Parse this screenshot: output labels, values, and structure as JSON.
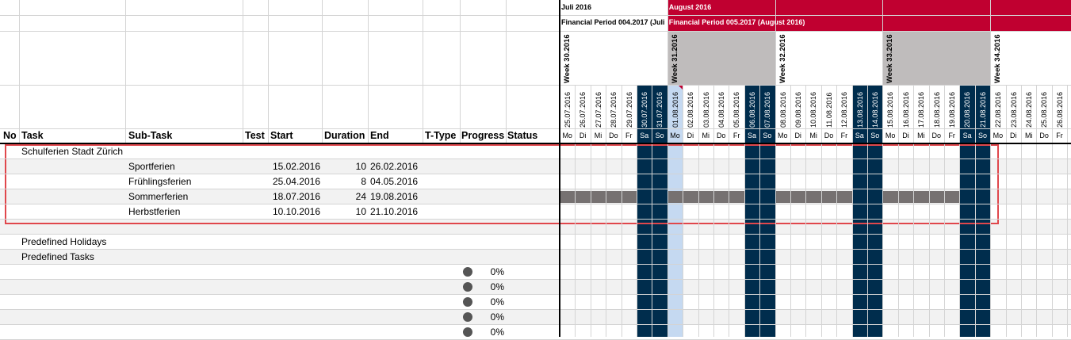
{
  "columns": {
    "no": "No",
    "task": "Task",
    "subtask": "Sub-Task",
    "test": "Test",
    "start": "Start",
    "duration": "Duration",
    "end": "End",
    "ttype": "T-Type",
    "progress": "Progress",
    "status": "Status"
  },
  "months": [
    {
      "label": "Juli 2016",
      "period": "Financial Period 004.2017 (Juli",
      "color": "#ffffff"
    },
    {
      "label": "August 2016",
      "period": "Financial Period 005.2017 (August 2016)",
      "color": "#c00030"
    }
  ],
  "weeks": [
    "Week 30.2016",
    "Week 31.2016",
    "Week 32.2016",
    "Week 33.2016",
    "Week 34.2016"
  ],
  "days": [
    {
      "date": "25.07.2016",
      "dow": "Mo"
    },
    {
      "date": "26.07.2016",
      "dow": "Di"
    },
    {
      "date": "27.07.2016",
      "dow": "Mi"
    },
    {
      "date": "28.07.2016",
      "dow": "Do"
    },
    {
      "date": "29.07.2016",
      "dow": "Fr"
    },
    {
      "date": "30.07.2016",
      "dow": "Sa"
    },
    {
      "date": "31.07.2016",
      "dow": "So"
    },
    {
      "date": "01.08.2016",
      "dow": "Mo"
    },
    {
      "date": "02.08.2016",
      "dow": "Di"
    },
    {
      "date": "03.08.2016",
      "dow": "Mi"
    },
    {
      "date": "04.08.2016",
      "dow": "Do"
    },
    {
      "date": "05.08.2016",
      "dow": "Fr"
    },
    {
      "date": "06.08.2016",
      "dow": "Sa"
    },
    {
      "date": "07.08.2016",
      "dow": "So"
    },
    {
      "date": "08.08.2016",
      "dow": "Mo"
    },
    {
      "date": "09.08.2016",
      "dow": "Di"
    },
    {
      "date": "10.08.2016",
      "dow": "Mi"
    },
    {
      "date": "11.08.2016",
      "dow": "Do"
    },
    {
      "date": "12.08.2016",
      "dow": "Fr"
    },
    {
      "date": "13.08.2016",
      "dow": "Sa"
    },
    {
      "date": "14.08.2016",
      "dow": "So"
    },
    {
      "date": "15.08.2016",
      "dow": "Mo"
    },
    {
      "date": "16.08.2016",
      "dow": "Di"
    },
    {
      "date": "17.08.2016",
      "dow": "Mi"
    },
    {
      "date": "18.08.2016",
      "dow": "Do"
    },
    {
      "date": "19.08.2016",
      "dow": "Fr"
    },
    {
      "date": "20.08.2016",
      "dow": "Sa"
    },
    {
      "date": "21.08.2016",
      "dow": "So"
    },
    {
      "date": "22.08.2016",
      "dow": "Mo"
    },
    {
      "date": "23.08.2016",
      "dow": "Di"
    },
    {
      "date": "24.08.2016",
      "dow": "Mi"
    },
    {
      "date": "25.08.2016",
      "dow": "Do"
    },
    {
      "date": "26.08.2016",
      "dow": "Fr"
    }
  ],
  "today_date": "01.08.2016",
  "rows": [
    {
      "task": "Schulferien Stadt Zürich",
      "subtask": "",
      "start": "",
      "duration": "",
      "end": "",
      "progress": "",
      "bar": null
    },
    {
      "task": "",
      "subtask": "Sportferien",
      "start": "15.02.2016",
      "duration": "10",
      "end": "26.02.2016",
      "progress": "",
      "bar": null
    },
    {
      "task": "",
      "subtask": "Frühlingsferien",
      "start": "25.04.2016",
      "duration": "8",
      "end": "04.05.2016",
      "progress": "",
      "bar": null
    },
    {
      "task": "",
      "subtask": "Sommerferien",
      "start": "18.07.2016",
      "duration": "24",
      "end": "19.08.2016",
      "progress": "",
      "bar": {
        "from": "25.07.2016",
        "to": "19.08.2016"
      }
    },
    {
      "task": "",
      "subtask": "Herbstferien",
      "start": "10.10.2016",
      "duration": "10",
      "end": "21.10.2016",
      "progress": "",
      "bar": null
    },
    {
      "task": "",
      "subtask": "",
      "start": "",
      "duration": "",
      "end": "",
      "progress": "",
      "bar": null
    },
    {
      "task": "Predefined Holidays",
      "subtask": "",
      "start": "",
      "duration": "",
      "end": "",
      "progress": "",
      "bar": null
    },
    {
      "task": "Predefined Tasks",
      "subtask": "",
      "start": "",
      "duration": "",
      "end": "",
      "progress": "",
      "bar": null
    },
    {
      "task": "",
      "subtask": "",
      "start": "",
      "duration": "",
      "end": "",
      "progress": "0%",
      "bar": null
    },
    {
      "task": "",
      "subtask": "",
      "start": "",
      "duration": "",
      "end": "",
      "progress": "0%",
      "bar": null
    },
    {
      "task": "",
      "subtask": "",
      "start": "",
      "duration": "",
      "end": "",
      "progress": "0%",
      "bar": null
    },
    {
      "task": "",
      "subtask": "",
      "start": "",
      "duration": "",
      "end": "",
      "progress": "0%",
      "bar": null
    },
    {
      "task": "",
      "subtask": "",
      "start": "",
      "duration": "",
      "end": "",
      "progress": "0%",
      "bar": null
    }
  ],
  "colors": {
    "weekend": "#002d4d",
    "today": "#c5d9f1",
    "bar": "#767171",
    "week_fill": "#bfbcbc",
    "month_accent": "#c00030",
    "highlight_border": "#e0474c",
    "row_alt": "#f2f2f2"
  }
}
